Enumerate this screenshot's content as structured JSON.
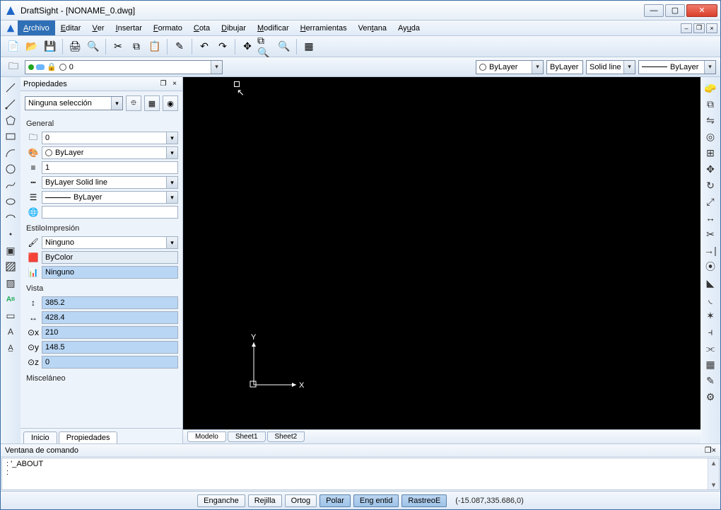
{
  "window": {
    "title": "DraftSight - [NONAME_0.dwg]"
  },
  "menu": {
    "items": [
      "Archivo",
      "Editar",
      "Ver",
      "Insertar",
      "Formato",
      "Cota",
      "Dibujar",
      "Modificar",
      "Herramientas",
      "Ventana",
      "Ayuda"
    ],
    "active_index": 0
  },
  "layer_bar": {
    "current_layer": "0",
    "color_combo": "ByLayer",
    "lw_combo": "ByLayer",
    "lt_combo": "Solid line",
    "style_combo": "ByLayer"
  },
  "props": {
    "panel_title": "Propiedades",
    "selection": "Ninguna selección",
    "groups": {
      "general": "General",
      "print": "EstiloImpresión",
      "view": "Vista",
      "misc": "Misceláneo"
    },
    "general": {
      "layer": "0",
      "color": "ByLayer",
      "scale": "1",
      "linetype": "ByLayer    Solid line",
      "lineweight": "ByLayer",
      "hyperlink": ""
    },
    "print": {
      "style": "Ninguno",
      "bycolor": "ByColor",
      "table": "Ninguno"
    },
    "view": {
      "h": "385.2",
      "w": "428.4",
      "cx": "210",
      "cy": "148.5",
      "cz": "0"
    }
  },
  "left_tabs": {
    "items": [
      "Inicio",
      "Propiedades"
    ],
    "active_index": 1
  },
  "sheet_tabs": {
    "items": [
      "Modelo",
      "Sheet1",
      "Sheet2"
    ],
    "active_index": 0
  },
  "cmd": {
    "title": "Ventana de comando",
    "lines": [
      ": '_ABOUT",
      "",
      ": "
    ]
  },
  "status": {
    "toggles": [
      {
        "label": "Enganche",
        "on": false
      },
      {
        "label": "Rejilla",
        "on": false
      },
      {
        "label": "Ortog",
        "on": false
      },
      {
        "label": "Polar",
        "on": true
      },
      {
        "label": "Eng entid",
        "on": true
      },
      {
        "label": "RastreoE",
        "on": true
      }
    ],
    "coords": "(-15.087,335.686,0)"
  },
  "ucs": {
    "x": "X",
    "y": "Y"
  }
}
